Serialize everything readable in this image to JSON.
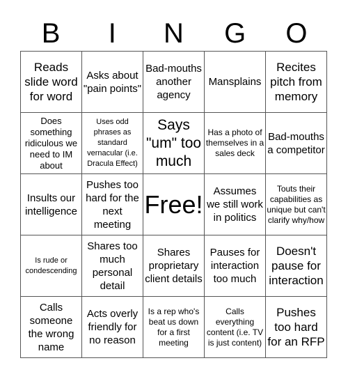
{
  "title_letters": [
    "B",
    "I",
    "N",
    "G",
    "O"
  ],
  "cells": [
    [
      "Reads slide word for word",
      "Asks about \"pain points\"",
      "Bad-mouths another agency",
      "Mansplains",
      "Recites pitch from memory"
    ],
    [
      "Does something ridiculous we need to IM about",
      "Uses odd phrases as standard vernacular (i.e. Dracula Effect)",
      "Says \"um\" too much",
      "Has a photo of themselves in a sales deck",
      "Bad-mouths a competitor"
    ],
    [
      "Insults our intelligence",
      "Pushes too hard for the next meeting",
      "Free!",
      "Assumes we still work in politics",
      "Touts their capabilities as unique but can't clarify why/how"
    ],
    [
      "Is rude or condescending",
      "Shares too much personal detail",
      "Shares proprietary client details",
      "Pauses for interaction too much",
      "Doesn't pause for interaction"
    ],
    [
      "Calls someone the wrong name",
      "Acts overly friendly for no reason",
      "Is a rep who's beat us down for a first meeting",
      "Calls everything content (i.e. TV is just content)",
      "Pushes too hard for an RFP"
    ]
  ]
}
